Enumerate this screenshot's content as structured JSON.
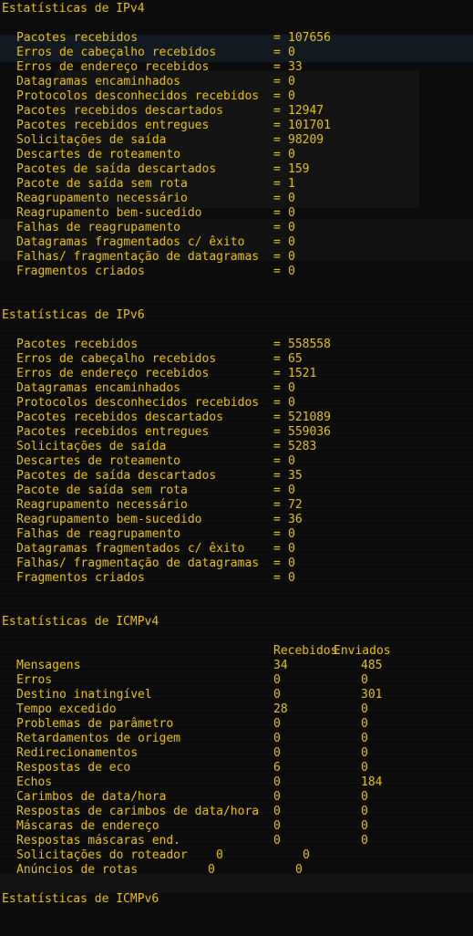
{
  "colors": {
    "background": "#0c0c0c",
    "text": "#e8c200"
  },
  "ipv4": {
    "title": "Estatísticas de IPv4",
    "rows": [
      {
        "label": "Pacotes recebidos",
        "value": "107656"
      },
      {
        "label": "Erros de cabeçalho recebidos",
        "value": "0"
      },
      {
        "label": "Erros de endereço recebidos",
        "value": "33"
      },
      {
        "label": "Datagramas encaminhados",
        "value": "0"
      },
      {
        "label": "Protocolos desconhecidos recebidos",
        "value": "0"
      },
      {
        "label": "Pacotes recebidos descartados",
        "value": "12947"
      },
      {
        "label": "Pacotes recebidos entregues",
        "value": "101701"
      },
      {
        "label": "Solicitações de saída",
        "value": "98209"
      },
      {
        "label": "Descartes de roteamento",
        "value": "0"
      },
      {
        "label": "Pacotes de saída descartados",
        "value": "159"
      },
      {
        "label": "Pacote de saída sem rota",
        "value": "1"
      },
      {
        "label": "Reagrupamento necessário",
        "value": "0"
      },
      {
        "label": "Reagrupamento bem-sucedido",
        "value": "0"
      },
      {
        "label": "Falhas de reagrupamento",
        "value": "0"
      },
      {
        "label": "Datagramas fragmentados c/ êxito",
        "value": "0"
      },
      {
        "label": "Falhas/ fragmentação de datagramas",
        "value": "0"
      },
      {
        "label": "Fragmentos criados",
        "value": "0"
      }
    ]
  },
  "ipv6": {
    "title": "Estatísticas de IPv6",
    "rows": [
      {
        "label": "Pacotes recebidos",
        "value": "558558"
      },
      {
        "label": "Erros de cabeçalho recebidos",
        "value": "65"
      },
      {
        "label": "Erros de endereço recebidos",
        "value": "1521"
      },
      {
        "label": "Datagramas encaminhados",
        "value": "0"
      },
      {
        "label": "Protocolos desconhecidos recebidos",
        "value": "0"
      },
      {
        "label": "Pacotes recebidos descartados",
        "value": "521089"
      },
      {
        "label": "Pacotes recebidos entregues",
        "value": "559036"
      },
      {
        "label": "Solicitações de saída",
        "value": "5283"
      },
      {
        "label": "Descartes de roteamento",
        "value": "0"
      },
      {
        "label": "Pacotes de saída descartados",
        "value": "35"
      },
      {
        "label": "Pacote de saída sem rota",
        "value": "0"
      },
      {
        "label": "Reagrupamento necessário",
        "value": "72"
      },
      {
        "label": "Reagrupamento bem-sucedido",
        "value": "36"
      },
      {
        "label": "Falhas de reagrupamento",
        "value": "0"
      },
      {
        "label": "Datagramas fragmentados c/ êxito",
        "value": "0"
      },
      {
        "label": "Falhas/ fragmentação de datagramas",
        "value": "0"
      },
      {
        "label": "Fragmentos criados",
        "value": "0"
      }
    ]
  },
  "icmpv4": {
    "title": "Estatísticas de ICMPv4",
    "col_received": "Recebidos",
    "col_sent": "Enviados",
    "rows": [
      {
        "label": "Mensagens",
        "received": "34",
        "sent": "485"
      },
      {
        "label": "Erros",
        "received": "0",
        "sent": "0"
      },
      {
        "label": "Destino inatingível",
        "received": "0",
        "sent": "301"
      },
      {
        "label": "Tempo excedido",
        "received": "28",
        "sent": "0"
      },
      {
        "label": "Problemas de parâmetro",
        "received": "0",
        "sent": "0"
      },
      {
        "label": "Retardamentos de origem",
        "received": "0",
        "sent": "0"
      },
      {
        "label": "Redirecionamentos",
        "received": "0",
        "sent": "0"
      },
      {
        "label": "Respostas de eco",
        "received": "6",
        "sent": "0"
      },
      {
        "label": "Echos",
        "received": "0",
        "sent": "184"
      },
      {
        "label": "Carimbos de data/hora",
        "received": "0",
        "sent": "0"
      },
      {
        "label": "Respostas de carimbos de data/hora",
        "received": "0",
        "sent": "0"
      },
      {
        "label": "Máscaras de endereço",
        "received": "0",
        "sent": "0"
      },
      {
        "label": "Respostas máscaras end.",
        "received": "0",
        "sent": "0"
      }
    ],
    "router_solicitations": {
      "label": "Solicitações do roteador",
      "received": "0",
      "sent": "0"
    },
    "router_advertisements": {
      "label": "Anúncios de rotas",
      "received": "0",
      "sent": "0"
    }
  },
  "icmpv6": {
    "title": "Estatísticas de ICMPv6"
  }
}
